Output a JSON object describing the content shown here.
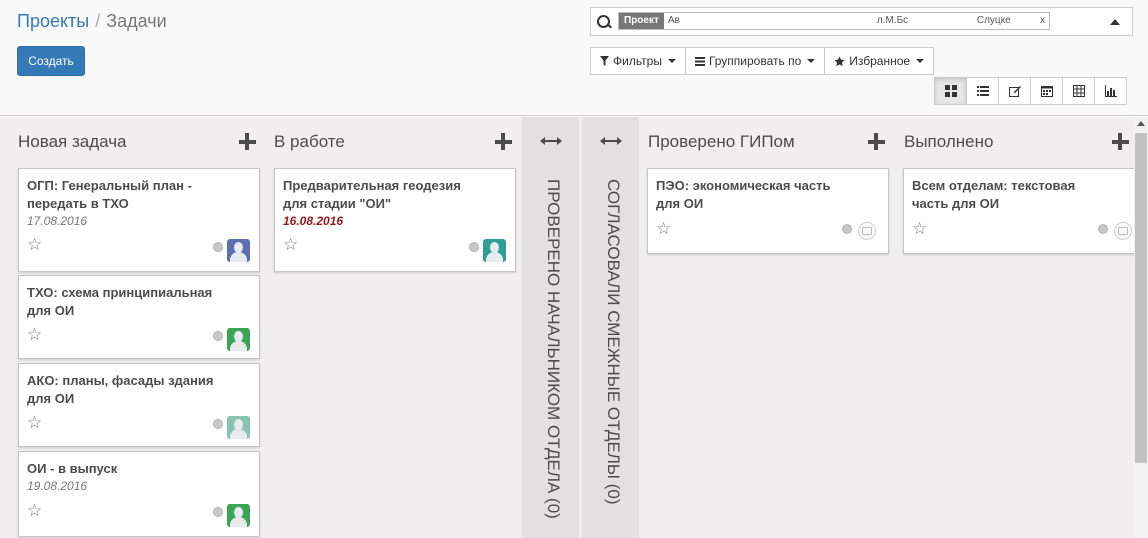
{
  "breadcrumb": {
    "parent": "Проекты",
    "separator": "/",
    "current": "Задачи"
  },
  "create_button": "Создать",
  "search": {
    "facet_label": "Проект",
    "facet_values": [
      "Ав",
      "л.М.Бс",
      "Слуцке"
    ],
    "facet_remove": "x"
  },
  "toolbar": {
    "filters": "Фильтры",
    "group_by": "Группировать по",
    "favorites": "Избранное"
  },
  "views": [
    "kanban-icon",
    "list-icon",
    "form-icon",
    "calendar-icon",
    "pivot-icon",
    "graph-icon"
  ],
  "columns": [
    {
      "title": "Новая задача",
      "cards": [
        {
          "title": "ОГП: Генеральный план - передать в ТХО",
          "date": "17.08.2016",
          "avatar_color": "#5b6fb5"
        },
        {
          "title": "ТХО: схема принципиальная для ОИ",
          "date": "",
          "avatar_color": "#3aa655"
        },
        {
          "title": "АКО: планы, фасады здания для ОИ",
          "date": "",
          "avatar_color": "#88c4b0"
        },
        {
          "title": "ОИ - в выпуск",
          "date": "19.08.2016",
          "avatar_color": "#3aa655"
        }
      ]
    },
    {
      "title": "В работе",
      "cards": [
        {
          "title": "Предварительная геодезия для стадии \"ОИ\"",
          "date": "16.08.2016",
          "date_overdue": true,
          "avatar_color": "#2f9e96"
        }
      ]
    },
    {
      "folded": true,
      "title": "ПРОВЕРЕНО НАЧАЛЬНИКОМ ОТДЕЛА (0)"
    },
    {
      "folded": true,
      "title": "СОГЛАСОВАЛИ СМЕЖНЫЕ ОТДЕЛЫ (0)"
    },
    {
      "title": "Проверено ГИПом",
      "cards": [
        {
          "title": "ПЭО: экономическая часть для ОИ",
          "date": ""
        }
      ]
    },
    {
      "title": "Выполнено",
      "cards": [
        {
          "title": "Всем отделам: текстовая часть для ОИ",
          "date": ""
        }
      ]
    }
  ]
}
